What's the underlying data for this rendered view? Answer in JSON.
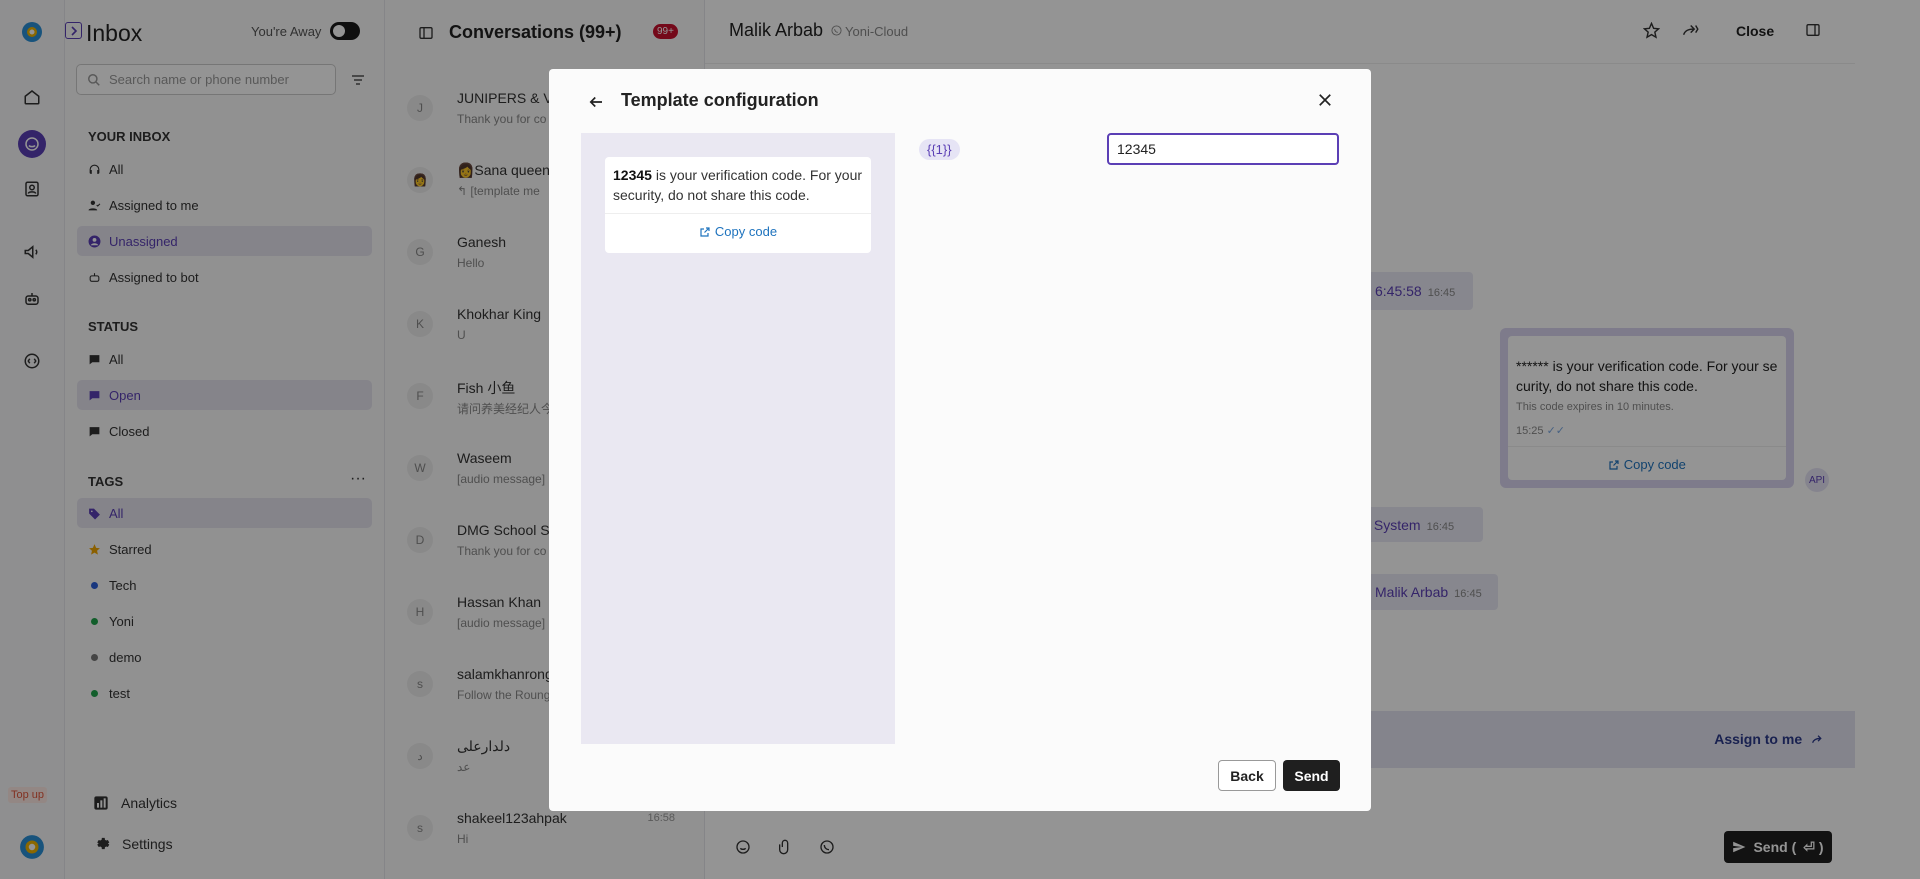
{
  "sidebar": {
    "title": "Inbox",
    "away_label": "You're Away",
    "search_placeholder": "Search name or phone number",
    "your_inbox_heading": "YOUR INBOX",
    "inbox_items": [
      "All",
      "Assigned to me",
      "Unassigned",
      "Assigned to bot"
    ],
    "status_heading": "STATUS",
    "status_items": [
      "All",
      "Open",
      "Closed"
    ],
    "tags_heading": "TAGS",
    "tags": [
      {
        "label": "All",
        "color": "#5b3fb5"
      },
      {
        "label": "Starred",
        "color": "#f0a500"
      },
      {
        "label": "Tech",
        "color": "#2b5fd9"
      },
      {
        "label": "Yoni",
        "color": "#1fa34a"
      },
      {
        "label": "demo",
        "color": "#777777"
      },
      {
        "label": "test",
        "color": "#1fa34a"
      }
    ],
    "top_up": "Top up",
    "analytics": "Analytics",
    "settings": "Settings"
  },
  "conversations": {
    "title": "Conversations (99+)",
    "badge": "99+",
    "items": [
      {
        "avatar": "J",
        "name": "JUNIPERS & VI",
        "msg": "Thank you for co",
        "time": ""
      },
      {
        "avatar": "👩",
        "name": "👩Sana queen",
        "msg": "↰ [template me",
        "time": ""
      },
      {
        "avatar": "G",
        "name": "Ganesh",
        "msg": "Hello",
        "time": ""
      },
      {
        "avatar": "K",
        "name": "Khokhar King",
        "msg": "U",
        "time": ""
      },
      {
        "avatar": "F",
        "name": "Fish 小鱼",
        "msg": "请问养美经纪人今",
        "time": ""
      },
      {
        "avatar": "W",
        "name": "Waseem",
        "msg": "[audio message]",
        "time": ""
      },
      {
        "avatar": "D",
        "name": "DMG School Sy",
        "msg": "Thank you for co",
        "time": ""
      },
      {
        "avatar": "H",
        "name": "Hassan Khan",
        "msg": "[audio message]",
        "time": ""
      },
      {
        "avatar": "s",
        "name": "salamkhanrong",
        "msg": "Follow the Roung",
        "time": ""
      },
      {
        "avatar": "د",
        "name": "دلدارعلی",
        "msg": "عد",
        "time": ""
      },
      {
        "avatar": "s",
        "name": "shakeel123ahpak",
        "msg": "Hi",
        "time": "16:58"
      }
    ]
  },
  "chat": {
    "contact": "Malik Arbab",
    "channel": "Yoni-Cloud",
    "close": "Close",
    "bubble1": {
      "text": "6:45:58",
      "time": "16:45"
    },
    "template": {
      "text": "****** is your verification code. For your se curity, do not share this code.",
      "expires": "This code expires in 10 minutes.",
      "time": "15:25",
      "copy": "Copy code"
    },
    "api": "API",
    "bubble2": {
      "text": "y System",
      "time": "16:45"
    },
    "bubble3": {
      "text": "Malik Arbab",
      "time": "16:45"
    },
    "assign": "Assign to me",
    "send": "Send ("
  },
  "modal": {
    "title": "Template configuration",
    "preview": {
      "code": "12345",
      "text": " is your verification code. For your security, do not share this code.",
      "copy": "Copy code"
    },
    "variable": "{{1}}",
    "value": "12345",
    "back": "Back",
    "send": "Send"
  },
  "colors": {
    "accent": "#5b3fb5",
    "link": "#1e73be",
    "dark": "#1f1f1f",
    "badge": "#c8102e"
  }
}
